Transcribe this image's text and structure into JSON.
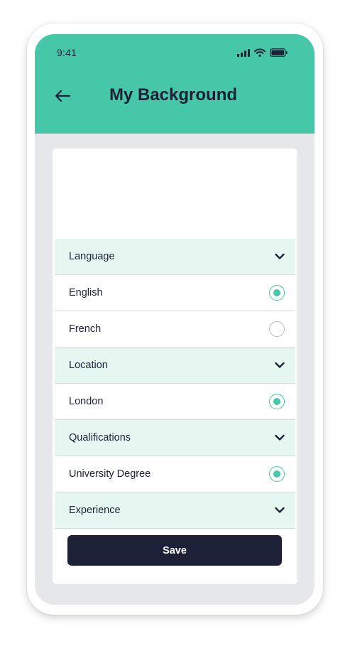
{
  "status_bar": {
    "time": "9:41"
  },
  "header": {
    "title": "My Background"
  },
  "list": {
    "language": {
      "label": "Language"
    },
    "english": {
      "label": "English",
      "selected": true
    },
    "french": {
      "label": "French",
      "selected": false
    },
    "location": {
      "label": "Location"
    },
    "london": {
      "label": "London",
      "selected": true
    },
    "qualifications": {
      "label": "Qualifications"
    },
    "university": {
      "label": "University Degree",
      "selected": true
    },
    "experience": {
      "label": "Experience"
    }
  },
  "actions": {
    "save_label": "Save"
  },
  "colors": {
    "accent": "#45c7a8",
    "section_bg": "#e6f7f2",
    "dark": "#1d2137",
    "screen_bg": "#e6e7ea"
  },
  "icons": {
    "back": "arrow-left-icon",
    "section_toggle": "chevron-down-icon",
    "signal": "signal-icon",
    "wifi": "wifi-icon",
    "battery": "battery-icon"
  }
}
